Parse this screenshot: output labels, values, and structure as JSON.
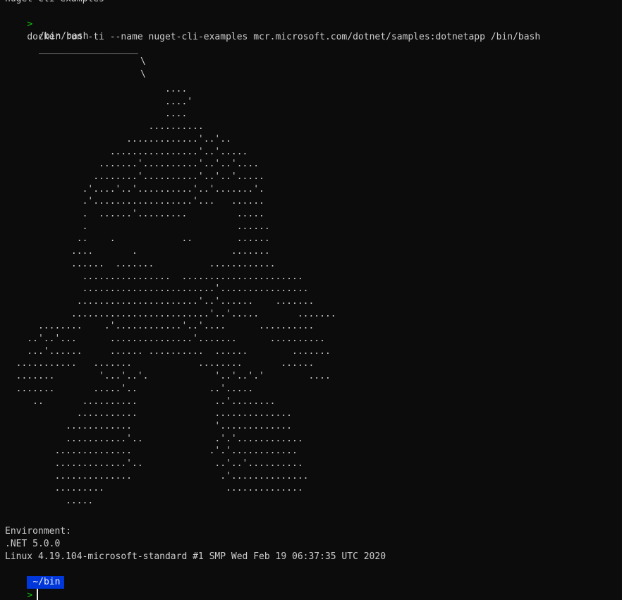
{
  "terminal": {
    "previous_output": "nuget-cli-examples",
    "prompt_symbol": ">",
    "command": "docker run -ti --name nuget-cli-examples mcr.microsoft.com/dotnet/samples:dotnetapp /bin/bash",
    "speech_bubble": {
      "text": "/bin/bash",
      "underline": "__________________",
      "tail_1": "\\",
      "tail_2": "\\"
    },
    "ascii_art": [
      "                             ....",
      "                             ....'",
      "                             ....",
      "                          ..........",
      "                      .............'..'..",
      "                   ................'..'.....",
      "                 .......'..........'..'..'....",
      "                ........'..........'..'..'.....",
      "              .'....'..'..........'..'.......'.",
      "              .'..................'...   ......",
      "              .  ......'.........         .....",
      "              .                           ......",
      "             ..    .            ..        ......",
      "            ....       .                 .......",
      "            ......  .......          ............",
      "              ................  ......................",
      "              ........................'................",
      "             ......................'..'......    .......",
      "            .........................'..'.....       .......",
      "      ........    .'............'..'....      ..........",
      "    ..'..'...      ...............'.......      ..........",
      "    ...'......     ...... ..........  ......        .......",
      "  ...........   .......            ........       ......",
      "  .......        '...'..'.            '..'..'.'        ....",
      "  .......       .....'..             ..'.....",
      "     ..       ..........              ..'........",
      "             ...........              ..............",
      "           ............               '.............",
      "           ...........'..             .'.'............",
      "         ..............              .'.'............",
      "         .............'..             ..'..'..........",
      "         ..............                .'..............",
      "         .........                      ..............",
      "           ....."
    ],
    "environment_label": "Environment:",
    "dotnet_version": ".NET 5.0.0",
    "os_info": "Linux 4.19.104-microsoft-standard #1 SMP Wed Feb 19 06:37:35 UTC 2020",
    "cwd": "~/bin"
  },
  "colors": {
    "background": "#0c0c0c",
    "foreground": "#cccccc",
    "prompt": "#16c60c",
    "cwd_badge_bg": "#0037da",
    "cwd_badge_fg": "#f2f2f2"
  }
}
